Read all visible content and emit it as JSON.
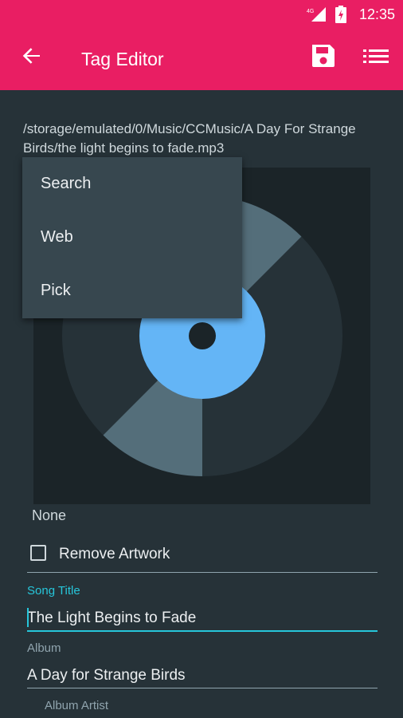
{
  "status_bar": {
    "time": "12:35",
    "signal_label": "4G"
  },
  "app_bar": {
    "title": "Tag Editor"
  },
  "file_path": "/storage/emulated/0/Music/CCMusic/A Day For Strange Birds/the light begins to fade.mp3",
  "artwork_menu": {
    "items": [
      "Search",
      "Web",
      "Pick"
    ]
  },
  "artwork": {
    "source_label": "None"
  },
  "remove_artwork": {
    "label": "Remove Artwork",
    "checked": false
  },
  "fields": {
    "song_title": {
      "label": "Song Title",
      "value": "The Light Begins to Fade"
    },
    "album": {
      "label": "Album",
      "value": "A Day for Strange Birds"
    },
    "album_artist": {
      "label": "Album Artist"
    }
  },
  "colors": {
    "accent": "#e91e63",
    "focus": "#26c6da",
    "background": "#263238",
    "menu": "#37474f"
  }
}
